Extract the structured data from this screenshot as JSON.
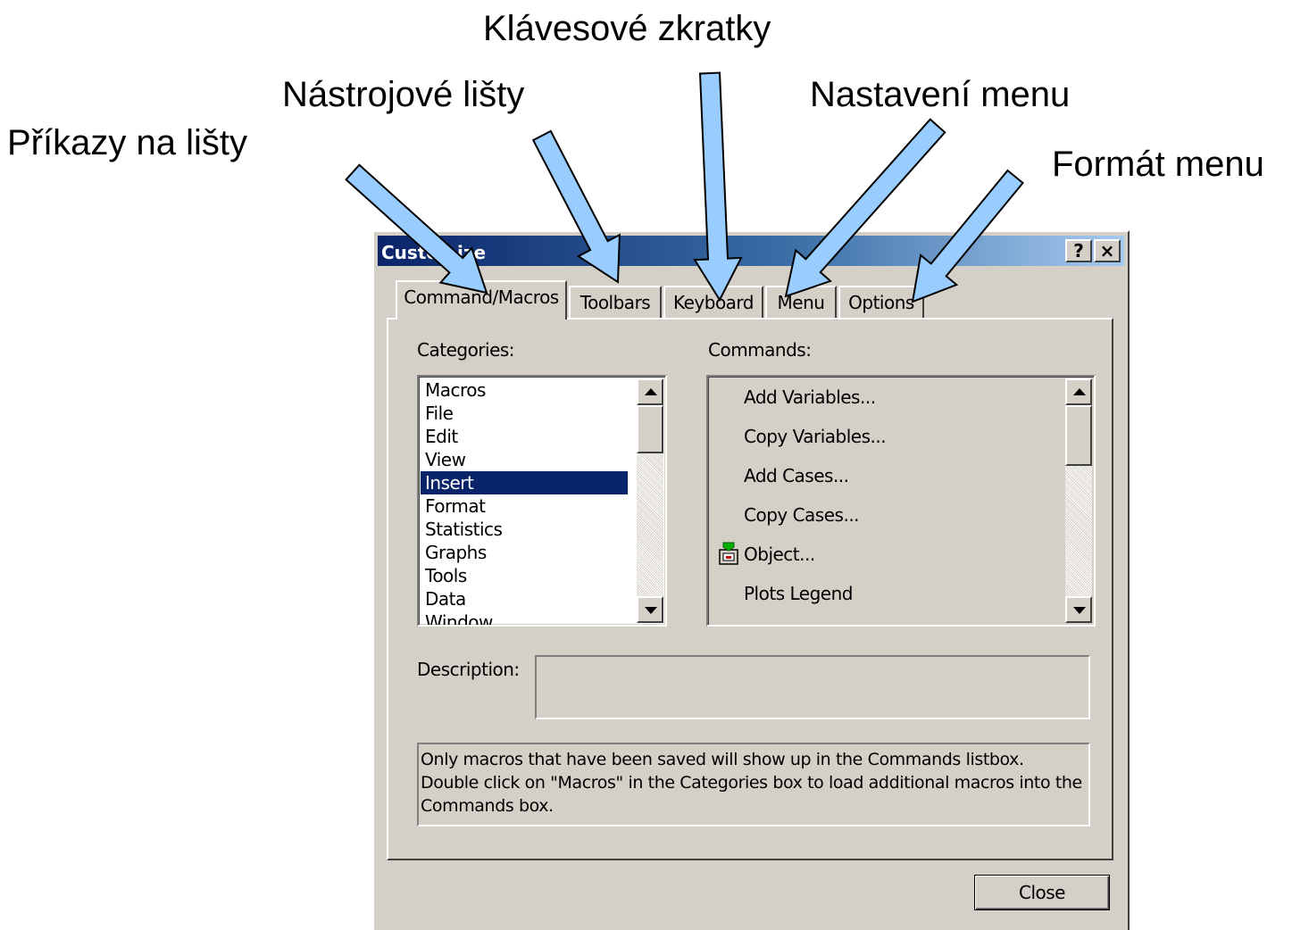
{
  "annotations": {
    "commands_to_toolbars": "Příkazy na lišty",
    "toolbars": "Nástrojové lišty",
    "keyboard_shortcuts": "Klávesové zkratky",
    "menu_settings": "Nastavení menu",
    "menu_format": "Formát menu"
  },
  "dialog": {
    "title": "Customize",
    "help_button": "?",
    "close_x": "×",
    "tabs": [
      {
        "label": "Command/Macros"
      },
      {
        "label": "Toolbars"
      },
      {
        "label": "Keyboard"
      },
      {
        "label": "Menu"
      },
      {
        "label": "Options"
      }
    ],
    "active_tab": "Command/Macros",
    "categories_label": "Categories:",
    "categories": [
      {
        "label": "Macros"
      },
      {
        "label": "File"
      },
      {
        "label": "Edit"
      },
      {
        "label": "View"
      },
      {
        "label": "Insert"
      },
      {
        "label": "Format"
      },
      {
        "label": "Statistics"
      },
      {
        "label": "Graphs"
      },
      {
        "label": "Tools"
      },
      {
        "label": "Data"
      },
      {
        "label": "Window"
      }
    ],
    "selected_category": "Insert",
    "commands_label": "Commands:",
    "commands": [
      {
        "label": "Add Variables...",
        "icon": ""
      },
      {
        "label": "Copy Variables...",
        "icon": ""
      },
      {
        "label": "Add Cases...",
        "icon": ""
      },
      {
        "label": "Copy Cases...",
        "icon": ""
      },
      {
        "label": "Object...",
        "icon": "insert-object-icon"
      },
      {
        "label": "Plots Legend",
        "icon": ""
      }
    ],
    "description_label": "Description:",
    "description_value": "",
    "info_text": "Only macros that have been saved will show up in the Commands listbox. Double click on \"Macros\" in the Categories box to load additional macros into the Commands box.",
    "close_button": "Close",
    "colors": {
      "face": "#d4d0c8",
      "title_start": "#0a246a",
      "title_end": "#a6caf0",
      "selection": "#0a246a",
      "arrow_fill": "#99ccff"
    }
  }
}
